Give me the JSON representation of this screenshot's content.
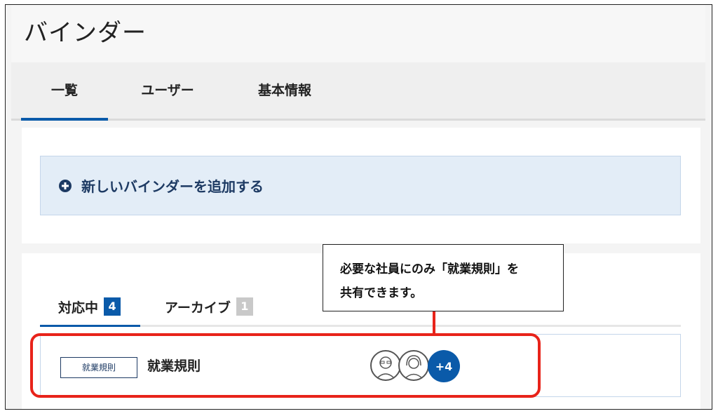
{
  "app": {
    "title": "バインダー"
  },
  "nav": {
    "tabs": [
      {
        "label": "一覧"
      },
      {
        "label": "ユーザー"
      },
      {
        "label": "基本情報"
      }
    ]
  },
  "add_binder": {
    "label": "新しいバインダーを追加する"
  },
  "subtabs": [
    {
      "label": "対応中",
      "count": "4"
    },
    {
      "label": "アーカイブ",
      "count": "1"
    }
  ],
  "binder_row": {
    "tag": "就業規則",
    "title": "就業規則",
    "more_members": "+4"
  },
  "callout": {
    "line1": "必要な社員にのみ「就業規則」を",
    "line2": "共有できます。"
  },
  "colors": {
    "accent": "#0a5aa9",
    "navy": "#1d3a63",
    "highlight": "#e8231a",
    "banner_bg": "#e3edf7"
  },
  "icons": [
    "plus-circle-icon",
    "avatar-icon"
  ]
}
